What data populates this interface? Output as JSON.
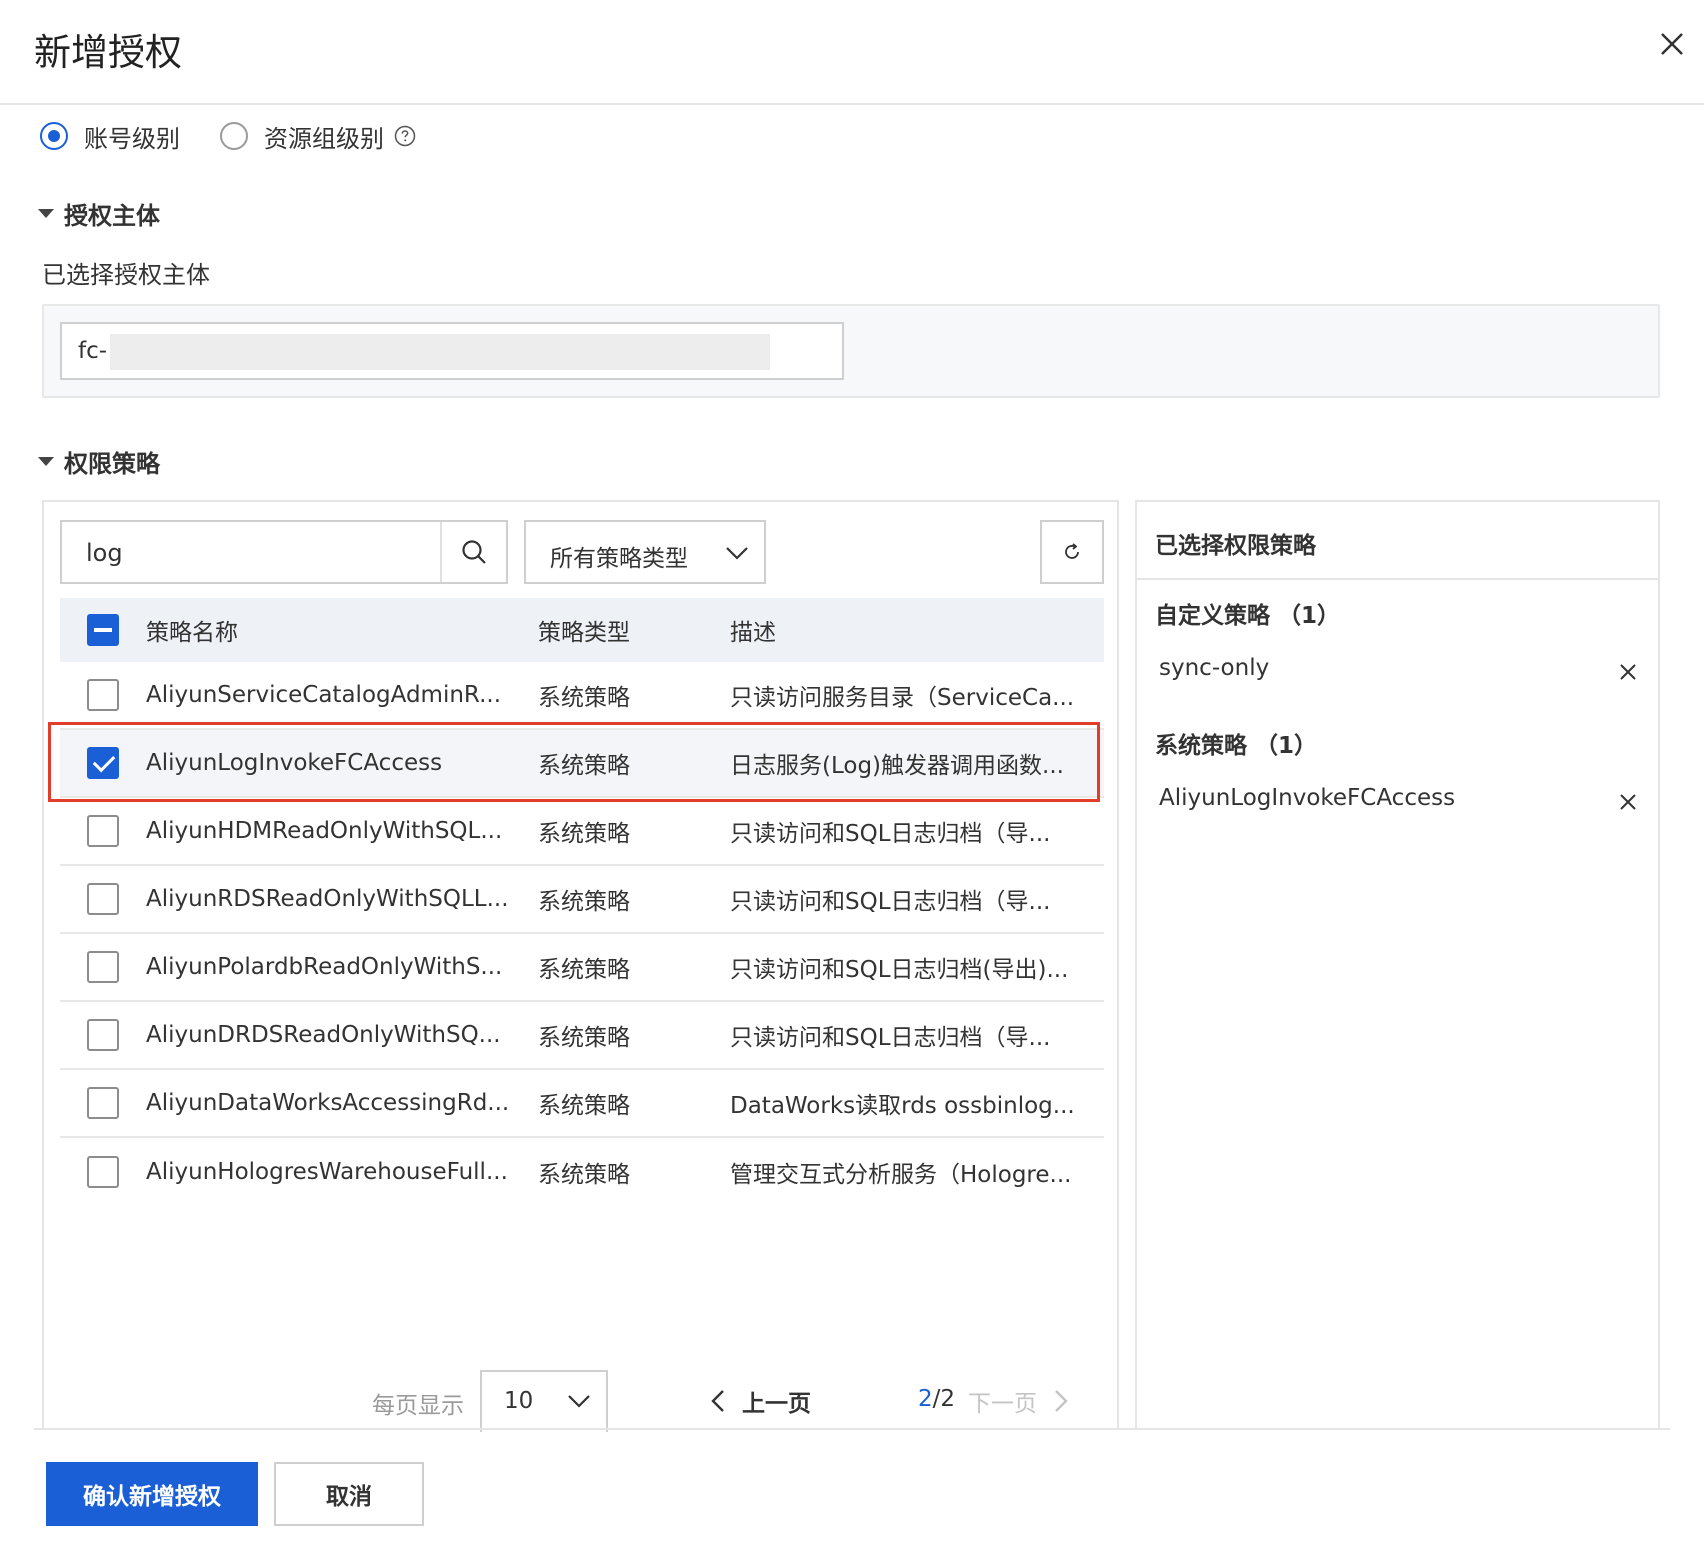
{
  "dialog": {
    "title": "新增授权"
  },
  "level": {
    "options": [
      {
        "label": "账号级别",
        "checked": true
      },
      {
        "label": "资源组级别",
        "checked": false
      }
    ]
  },
  "principal": {
    "section_title": "授权主体",
    "selected_label": "已选择授权主体",
    "value_prefix": "fc-"
  },
  "policy": {
    "section_title": "权限策略",
    "search_value": "log",
    "type_filter": "所有策略类型",
    "columns": {
      "name": "策略名称",
      "type": "策略类型",
      "desc": "描述"
    },
    "rows": [
      {
        "name": "AliyunServiceCatalogAdminR...",
        "type": "系统策略",
        "desc": "只读访问服务目录（ServiceCa...",
        "checked": false
      },
      {
        "name": "AliyunLogInvokeFCAccess",
        "type": "系统策略",
        "desc": "日志服务(Log)触发器调用函数...",
        "checked": true
      },
      {
        "name": "AliyunHDMReadOnlyWithSQL...",
        "type": "系统策略",
        "desc": "只读访问和SQL日志归档（导...",
        "checked": false
      },
      {
        "name": "AliyunRDSReadOnlyWithSQLL...",
        "type": "系统策略",
        "desc": "只读访问和SQL日志归档（导...",
        "checked": false
      },
      {
        "name": "AliyunPolardbReadOnlyWithS...",
        "type": "系统策略",
        "desc": "只读访问和SQL日志归档(导出)...",
        "checked": false
      },
      {
        "name": "AliyunDRDSReadOnlyWithSQ...",
        "type": "系统策略",
        "desc": "只读访问和SQL日志归档（导...",
        "checked": false
      },
      {
        "name": "AliyunDataWorksAccessingRd...",
        "type": "系统策略",
        "desc": "DataWorks读取rds ossbinlog...",
        "checked": false
      },
      {
        "name": "AliyunHologresWarehouseFull...",
        "type": "系统策略",
        "desc": "管理交互式分析服务（Hologre...",
        "checked": false
      }
    ],
    "pagination": {
      "per_page_label": "每页显示",
      "per_page": "10",
      "prev_label": "上一页",
      "current_page": "2",
      "total_pages": "/2",
      "next_label": "下一页"
    }
  },
  "selected": {
    "title": "已选择权限策略",
    "custom_group": "自定义策略 （1）",
    "custom_items": [
      "sync-only"
    ],
    "system_group": "系统策略 （1）",
    "system_items": [
      "AliyunLogInvokeFCAccess"
    ]
  },
  "footer": {
    "confirm_label": "确认新增授权",
    "cancel_label": "取消"
  },
  "colors": {
    "primary": "#1a5fd6",
    "highlight_border": "#e23d2b"
  }
}
